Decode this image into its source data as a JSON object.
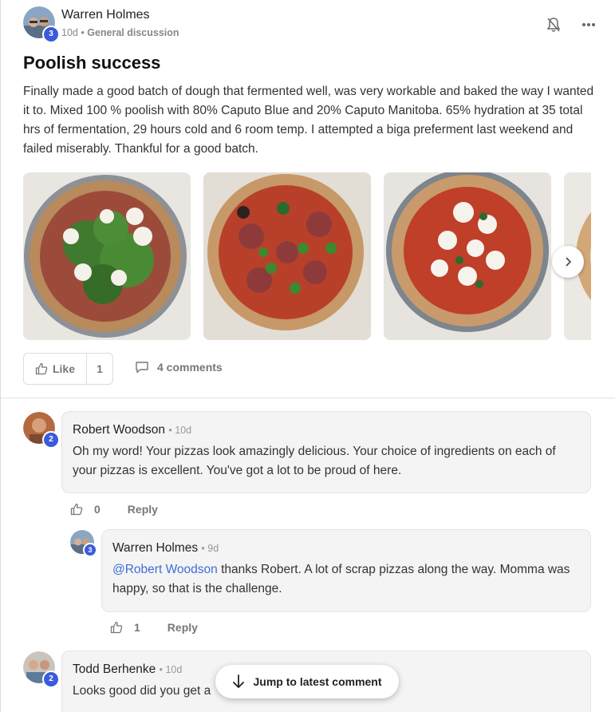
{
  "post": {
    "author": "Warren Holmes",
    "author_level": "3",
    "age": "10d",
    "separator": "•",
    "group": "General discussion",
    "title": "Poolish success",
    "body": "Finally made a good batch of dough that fermented well, was very workable and baked the way I wanted it to. Mixed 100 % poolish with 80% Caputo Blue and 20% Caputo Manitoba. 65% hydration at 35 total hrs of fermentation, 29 hours cold and 6 room temp. I attempted a biga preferment last weekend and failed miserably. Thankful for a good batch.",
    "like_label": "Like",
    "like_count": "1",
    "comments_label": "4 comments",
    "icons": [
      "bell-off-icon",
      "more-icon",
      "chevron-right-icon",
      "thumbs-up-icon",
      "comment-icon",
      "arrow-down-icon"
    ]
  },
  "comments": [
    {
      "author": "Robert Woodson",
      "level": "2",
      "time": "• 10d",
      "text": "Oh my word! Your pizzas look amazingly delicious. Your choice of ingredients on each of your pizzas is excellent. You've got a lot to be proud of here.",
      "likes": "0",
      "reply_label": "Reply"
    },
    {
      "author": "Warren Holmes",
      "level": "3",
      "time": "• 9d",
      "mention": "@Robert Woodson",
      "text": " thanks Robert. A lot of scrap pizzas along the way. Momma was happy, so that is the challenge.",
      "likes": "1",
      "reply_label": "Reply"
    },
    {
      "author": "Todd Berhenke",
      "level": "2",
      "time": "• 10d",
      "text": "Looks good did you get a",
      "likes": "",
      "reply_label": ""
    }
  ],
  "jump_label": "Jump to latest comment",
  "colors": {
    "accent": "#3b5bdb",
    "mention": "#3b6fd6",
    "bubble": "#f4f4f4"
  }
}
